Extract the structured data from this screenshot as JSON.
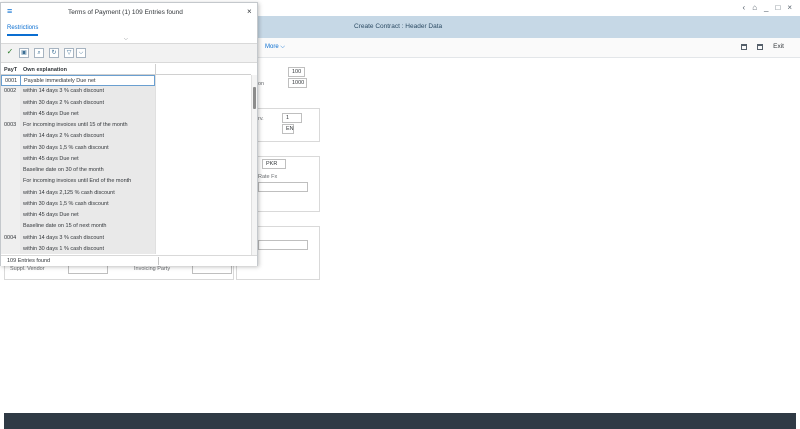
{
  "window": {
    "app_title": "Create Contract : Header Data",
    "controls": [
      "‹",
      "⌂",
      "_",
      "□",
      "×"
    ]
  },
  "toolbar": {
    "more_label": "More",
    "exit_label": "Exit"
  },
  "form": {
    "fields": [
      {
        "label": "",
        "value": "100"
      },
      {
        "label": "on",
        "value": "1000"
      },
      {
        "label": "rv.",
        "value": "1"
      },
      {
        "label": "",
        "value": "EN"
      },
      {
        "label": "",
        "value": "PKR"
      },
      {
        "label": "Rate Fx",
        "value": ""
      }
    ],
    "supplier": {
      "vendor_label": "Suppl. Vendor",
      "invoicing_label": "Invoicing Party"
    }
  },
  "popup": {
    "menu_icon": "menu-icon",
    "title": "Terms of Payment (1)  109 Entries found",
    "close_icon": "×",
    "tab_label": "Restrictions",
    "columns": [
      "PayT",
      "Own explanation"
    ],
    "rows": [
      {
        "code": "0001",
        "text": "Payable immediately Due net",
        "selected": true
      },
      {
        "code": "0002",
        "text": "within 14 days 3 % cash discount"
      },
      {
        "code": "",
        "text": "within 30 days 2 % cash discount"
      },
      {
        "code": "",
        "text": "within 45 days Due net"
      },
      {
        "code": "0003",
        "text": "For incoming invoices until 15 of the month"
      },
      {
        "code": "",
        "text": "within 14 days 2 % cash discount"
      },
      {
        "code": "",
        "text": "within 30 days 1,5 % cash discount"
      },
      {
        "code": "",
        "text": "within 45 days Due net"
      },
      {
        "code": "",
        "text": "Baseline date on 30 of the month"
      },
      {
        "code": "",
        "text": "For incoming invoices until End  of the month"
      },
      {
        "code": "",
        "text": "within 14 days 2,125 % cash discount"
      },
      {
        "code": "",
        "text": "within 30 days 1,5 % cash discount"
      },
      {
        "code": "",
        "text": "within 45 days Due net"
      },
      {
        "code": "",
        "text": "Baseline date on 15 of next month"
      },
      {
        "code": "0004",
        "text": "within 14 days 3 % cash discount"
      },
      {
        "code": "",
        "text": "within 30 days 1 % cash discount"
      }
    ],
    "status_text": "109 Entries found"
  }
}
